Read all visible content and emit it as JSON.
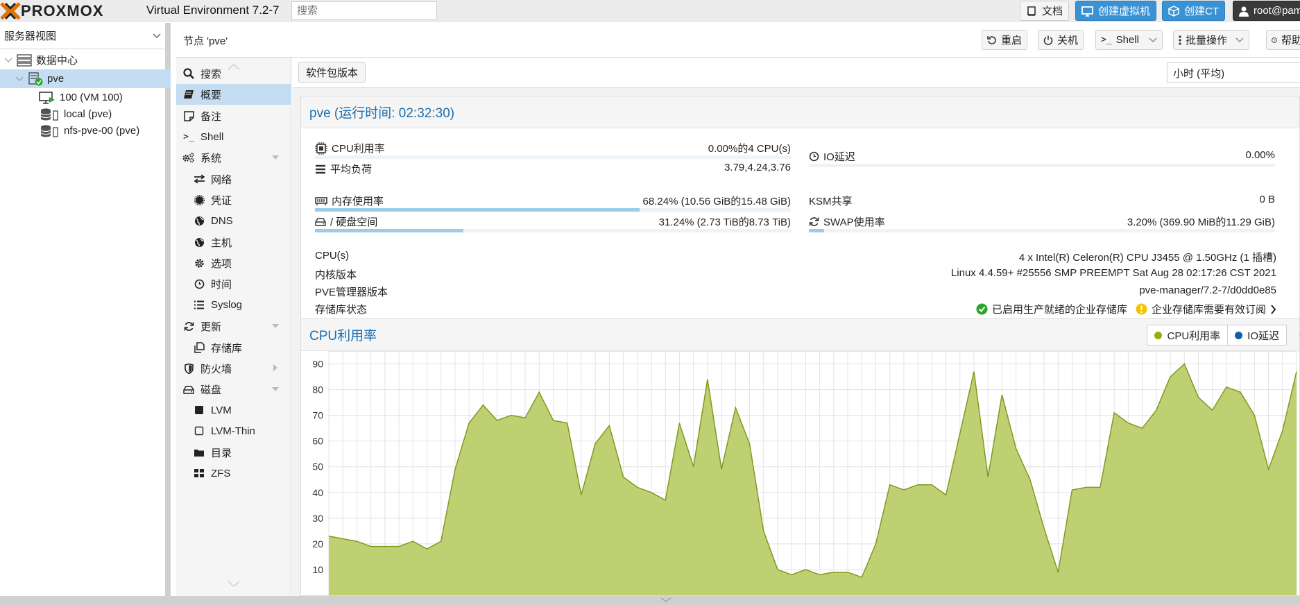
{
  "app": {
    "version": "Virtual Environment 7.2-7",
    "search_placeholder": "搜索"
  },
  "topbar": {
    "docs": "文档",
    "create_vm": "创建虚拟机",
    "create_ct": "创建CT",
    "user": "root@pam"
  },
  "sidebar": {
    "view": "服务器视图",
    "tree": [
      {
        "label": "数据中心",
        "type": "datacenter"
      },
      {
        "label": "pve",
        "type": "node"
      },
      {
        "label": "100 (VM 100)",
        "type": "vm"
      },
      {
        "label": "local (pve)",
        "type": "storage"
      },
      {
        "label": "nfs-pve-00 (pve)",
        "type": "storage"
      }
    ]
  },
  "node_header": {
    "title": "节点 'pve'",
    "reboot": "重启",
    "shutdown": "关机",
    "shell": "Shell",
    "bulk": "批量操作",
    "help": "帮助"
  },
  "menu": [
    {
      "label": "搜索",
      "icon": "search-icon",
      "level": 0
    },
    {
      "label": "概要",
      "icon": "book-icon",
      "level": 0,
      "selected": true
    },
    {
      "label": "备注",
      "icon": "note-icon",
      "level": 0
    },
    {
      "label": "Shell",
      "icon": "terminal-icon",
      "level": 0
    },
    {
      "label": "系统",
      "icon": "cogs-icon",
      "level": 0,
      "expanded": true
    },
    {
      "label": "网络",
      "icon": "exchange-icon",
      "level": 1
    },
    {
      "label": "凭证",
      "icon": "certificate-icon",
      "level": 1
    },
    {
      "label": "DNS",
      "icon": "globe-icon",
      "level": 1
    },
    {
      "label": "主机",
      "icon": "globe-icon",
      "level": 1
    },
    {
      "label": "选项",
      "icon": "gear-icon",
      "level": 1
    },
    {
      "label": "时间",
      "icon": "clock-icon",
      "level": 1
    },
    {
      "label": "Syslog",
      "icon": "list-icon",
      "level": 1
    },
    {
      "label": "更新",
      "icon": "refresh-icon",
      "level": 0,
      "expanded": true
    },
    {
      "label": "存储库",
      "icon": "files-icon",
      "level": 1
    },
    {
      "label": "防火墙",
      "icon": "shield-icon",
      "level": 0,
      "collapsed": true
    },
    {
      "label": "磁盘",
      "icon": "hdd-icon",
      "level": 0,
      "expanded": true
    },
    {
      "label": "LVM",
      "icon": "square-icon",
      "level": 1
    },
    {
      "label": "LVM-Thin",
      "icon": "square-outline-icon",
      "level": 1
    },
    {
      "label": "目录",
      "icon": "folder-icon",
      "level": 1
    },
    {
      "label": "ZFS",
      "icon": "th-large-icon",
      "level": 1
    }
  ],
  "toolbar": {
    "package_versions": "软件包版本",
    "timeframe": "小时 (平均)"
  },
  "status": {
    "title": "pve (运行时间: 02:32:30)",
    "cpu": {
      "label": "CPU利用率",
      "value": "0.00%的4 CPU(s)",
      "fraction": 0.0
    },
    "load": {
      "label": "平均负荷",
      "value": "3.79,4.24,3.76"
    },
    "io": {
      "label": "IO延迟",
      "value": "0.00%",
      "fraction": 0.0
    },
    "mem": {
      "label": "内存使用率",
      "value": "68.24% (10.56 GiB的15.48 GiB)",
      "fraction": 0.6824
    },
    "ksm": {
      "label": "KSM共享",
      "value": "0 B"
    },
    "disk": {
      "label": "/ 硬盘空间",
      "value": "31.24% (2.73 TiB的8.73 TiB)",
      "fraction": 0.3124
    },
    "swap": {
      "label": "SWAP使用率",
      "value": "3.20% (369.90 MiB的11.29 GiB)",
      "fraction": 0.032
    },
    "cpus": {
      "label": "CPU(s)",
      "value": "4 x Intel(R) Celeron(R) CPU J3455 @ 1.50GHz (1 插槽)"
    },
    "kernel": {
      "label": "内核版本",
      "value": "Linux 4.4.59+ #25556 SMP PREEMPT Sat Aug 28 02:17:26 CST 2021"
    },
    "pve": {
      "label": "PVE管理器版本",
      "value": "pve-manager/7.2-7/d0dd0e85"
    },
    "repo": {
      "label": "存储库状态",
      "ok": "已启用生产就绪的企业存储库",
      "warn": "企业存储库需要有效订阅"
    }
  },
  "colors": {
    "accent": "#1a6fb0",
    "cpu_series": "#94ae0a",
    "io_series": "#115fa6",
    "area_fill": "#bccd6b"
  },
  "chart_data": {
    "type": "area",
    "title": "CPU利用率",
    "ylim": [
      0,
      95
    ],
    "yticks": [
      10,
      20,
      30,
      40,
      50,
      60,
      70,
      80,
      90
    ],
    "series": [
      {
        "name": "CPU利用率",
        "values": [
          23,
          22,
          21,
          19,
          19,
          19,
          21,
          18,
          21,
          49,
          67,
          74,
          68,
          70,
          69,
          79,
          68,
          67,
          39,
          59,
          66,
          46,
          42,
          40,
          37,
          67,
          50,
          84,
          49,
          73,
          59,
          25,
          10,
          8,
          10,
          8,
          9,
          9,
          7,
          20,
          43,
          41,
          43,
          43,
          39,
          63,
          87,
          46,
          78,
          57,
          45,
          26,
          9,
          41,
          42,
          42,
          71,
          67,
          65,
          72,
          85,
          90,
          77,
          72,
          81,
          79,
          70,
          49,
          64,
          87
        ]
      },
      {
        "name": "IO延迟",
        "values": []
      }
    ]
  }
}
